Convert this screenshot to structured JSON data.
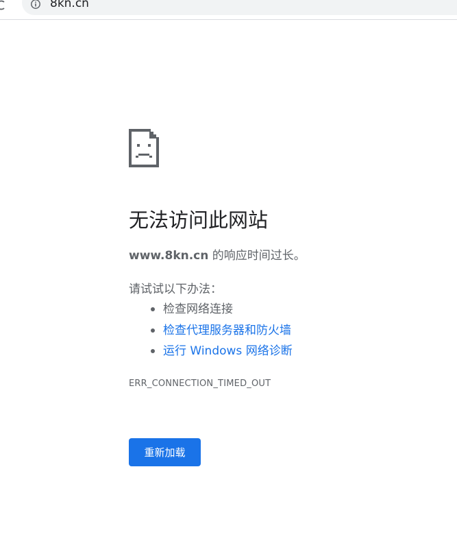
{
  "address_bar": {
    "url": "8kn.cn"
  },
  "error_page": {
    "title": "无法访问此网站",
    "summary_host": "www.8kn.cn",
    "summary_rest": " 的响应时间过长。",
    "suggestions_intro": "请试试以下办法：",
    "suggestions": [
      {
        "label": "检查网络连接",
        "link": false
      },
      {
        "label": "检查代理服务器和防火墙",
        "link": true
      },
      {
        "label": "运行 Windows 网络诊断",
        "link": true
      }
    ],
    "error_code": "ERR_CONNECTION_TIMED_OUT",
    "reload_label": "重新加载"
  },
  "colors": {
    "link": "#1a73e8",
    "button": "#1a73e8",
    "secondary_text": "#5f6368",
    "title_text": "#202124"
  },
  "icons": {
    "page": "sad-page-icon",
    "info": "info-icon",
    "reload": "reload-icon"
  }
}
